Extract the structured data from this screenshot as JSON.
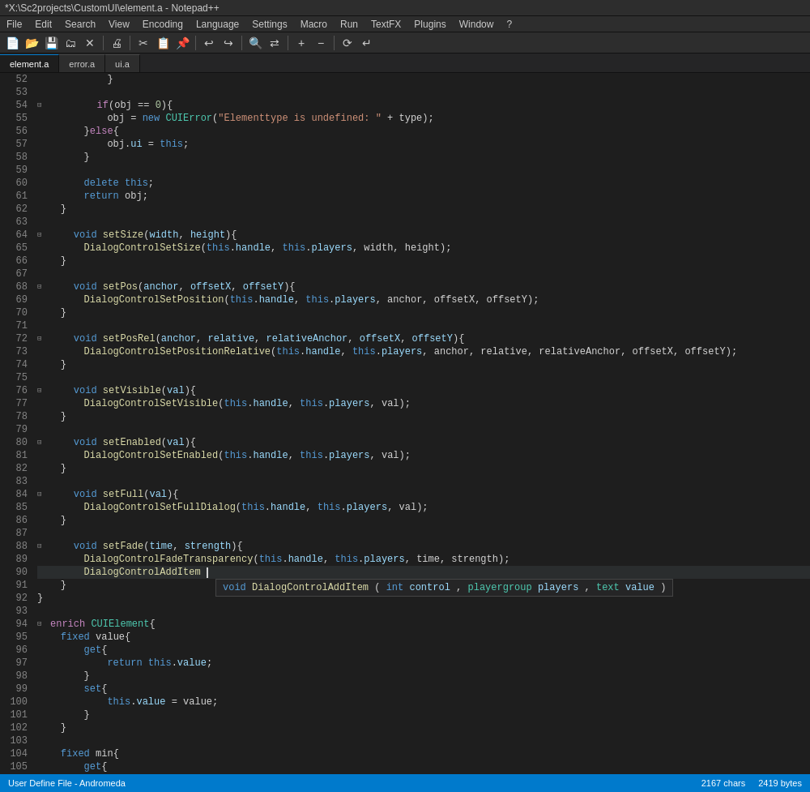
{
  "titleBar": {
    "text": "*X:\\Sc2projects\\CustomUI\\element.a - Notepad++"
  },
  "menuBar": {
    "items": [
      "File",
      "Edit",
      "Search",
      "View",
      "Encoding",
      "Language",
      "Settings",
      "Macro",
      "Run",
      "TextFX",
      "Plugins",
      "Window",
      "?"
    ]
  },
  "tabs": [
    {
      "label": "element.a",
      "active": true
    },
    {
      "label": "error.a",
      "active": false
    },
    {
      "label": "ui.a",
      "active": false
    }
  ],
  "statusBar": {
    "left": "User Define File - Andromeda",
    "chars": "2167 chars",
    "bytes": "2419 bytes"
  },
  "autocomplete": {
    "text": "void DialogControlAddItem (int control, playergroup players, text value)"
  },
  "colors": {
    "keyword": "#569cd6",
    "keyword2": "#c586c0",
    "function": "#dcdcaa",
    "string": "#ce9178",
    "number": "#b5cea8",
    "type": "#4ec9b0",
    "comment": "#6a9955",
    "param": "#9cdcfe",
    "plain": "#d4d4d4"
  }
}
